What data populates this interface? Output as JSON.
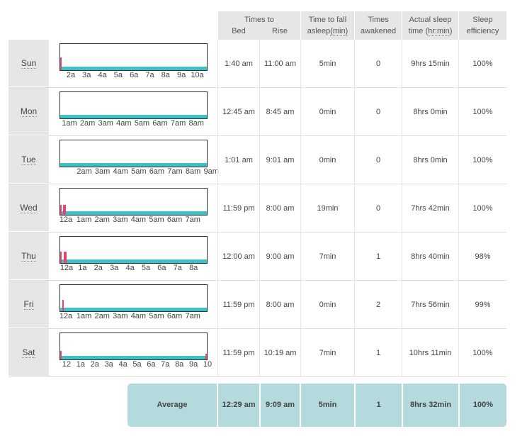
{
  "header": {
    "times_to": "Times to",
    "bed": "Bed",
    "rise": "Rise",
    "fall_asleep_l1": "Time to fall",
    "fall_asleep_l2a": "asleep",
    "fall_asleep_l2b": "(min)",
    "awakened_l1": "Times",
    "awakened_l2": "awakened",
    "actual_l1": "Actual sleep",
    "actual_l2a": "time (",
    "actual_l2b": "hr:min",
    "actual_l2c": ")",
    "eff_l1": "Sleep",
    "eff_l2": "efficiency"
  },
  "rows": [
    {
      "day": "Sun",
      "bed": "1:40 am",
      "rise": "11:00 am",
      "fall": "5min",
      "awake": "0",
      "actual": "9hrs 15min",
      "eff": "100%",
      "ticks": [
        "2a",
        "3a",
        "4a",
        "5a",
        "6a",
        "7a",
        "8a",
        "9a",
        "10a"
      ]
    },
    {
      "day": "Mon",
      "bed": "12:45 am",
      "rise": "8:45 am",
      "fall": "0min",
      "awake": "0",
      "actual": "8hrs 0min",
      "eff": "100%",
      "ticks": [
        "1am",
        "2am",
        "3am",
        "4am",
        "5am",
        "6am",
        "7am",
        "8am"
      ]
    },
    {
      "day": "Tue",
      "bed": "1:01 am",
      "rise": "9:01 am",
      "fall": "0min",
      "awake": "0",
      "actual": "8hrs 0min",
      "eff": "100%",
      "ticks": [
        "2am",
        "3am",
        "4am",
        "5am",
        "6am",
        "7am",
        "8am",
        "9am"
      ]
    },
    {
      "day": "Wed",
      "bed": "11:59 pm",
      "rise": "8:00 am",
      "fall": "19min",
      "awake": "0",
      "actual": "7hrs 42min",
      "eff": "100%",
      "ticks": [
        "12a",
        "1am",
        "2am",
        "3am",
        "4am",
        "5am",
        "6am",
        "7am"
      ]
    },
    {
      "day": "Thu",
      "bed": "12:00 am",
      "rise": "9:00 am",
      "fall": "7min",
      "awake": "1",
      "actual": "8hrs 40min",
      "eff": "98%",
      "ticks": [
        "12a",
        "1a",
        "2a",
        "3a",
        "4a",
        "5a",
        "6a",
        "7a",
        "8a"
      ]
    },
    {
      "day": "Fri",
      "bed": "11:59 pm",
      "rise": "8:00 am",
      "fall": "0min",
      "awake": "2",
      "actual": "7hrs 56min",
      "eff": "99%",
      "ticks": [
        "12a",
        "1am",
        "2am",
        "3am",
        "4am",
        "5am",
        "6am",
        "7am"
      ]
    },
    {
      "day": "Sat",
      "bed": "11:59 pm",
      "rise": "10:19 am",
      "fall": "7min",
      "awake": "1",
      "actual": "10hrs 11min",
      "eff": "100%",
      "ticks": [
        "12",
        "1a",
        "2a",
        "3a",
        "4a",
        "5a",
        "6a",
        "7a",
        "8a",
        "9a",
        "10"
      ]
    }
  ],
  "average": {
    "label": "Average",
    "bed": "12:29 am",
    "rise": "9:09 am",
    "fall": "5min",
    "awake": "1",
    "actual": "8hrs 32min",
    "eff": "100%"
  },
  "colors": {
    "asleep": "#3cc1c7",
    "awake": "#e8436f",
    "header_bg": "#e6e6e6",
    "average_bg": "#b5dadd"
  }
}
